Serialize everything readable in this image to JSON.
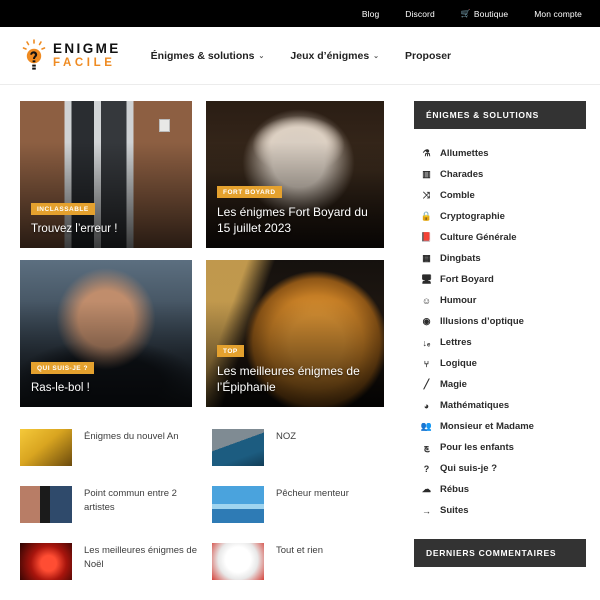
{
  "topbar": {
    "links": [
      {
        "label": "Blog",
        "icon": null
      },
      {
        "label": "Discord",
        "icon": null
      },
      {
        "label": "Boutique",
        "icon": "cart-icon",
        "glyph": "🛒"
      },
      {
        "label": "Mon compte",
        "icon": null
      }
    ]
  },
  "header": {
    "logo": {
      "line1": "ENIGME",
      "line2": "FACILE",
      "icon": "lightbulb-icon"
    },
    "nav": [
      {
        "label": "Énigmes & solutions",
        "has_caret": true,
        "caret": "⌄"
      },
      {
        "label": "Jeux d’énigmes",
        "has_caret": true,
        "caret": "⌄"
      },
      {
        "label": "Proposer",
        "has_caret": false,
        "caret": ""
      }
    ]
  },
  "cards": [
    {
      "badge": "INCLASSABLE",
      "title": "Trouvez l’erreur !",
      "image": "img-door",
      "name": "card-trouvez-l-erreur"
    },
    {
      "badge": "FORT BOYARD",
      "title": "Les énigmes Fort Boyard du 15 juillet 2023",
      "image": "img-boyard",
      "name": "card-fort-boyard"
    },
    {
      "badge": "QUI SUIS-JE ?",
      "title": "Ras-le-bol !",
      "image": "img-scream",
      "name": "card-ras-le-bol"
    },
    {
      "badge": "TOP",
      "title": "Les meilleures énigmes de l’Épiphanie",
      "image": "img-galette",
      "name": "card-epiphanie"
    }
  ],
  "article_list": [
    {
      "title": "Énigmes du nouvel An",
      "thumb": "th-nye"
    },
    {
      "title": "NOZ",
      "thumb": "th-noz"
    },
    {
      "title": "Point commun entre 2 artistes",
      "thumb": "th-artists"
    },
    {
      "title": "Pêcheur menteur",
      "thumb": "th-pecheur"
    },
    {
      "title": "Les meilleures énigmes de Noël",
      "thumb": "th-noel"
    },
    {
      "title": "Tout et rien",
      "thumb": "th-tout"
    }
  ],
  "sidebar": {
    "widget_title": "ÉNIGMES & SOLUTIONS",
    "comments_title": "DERNIERS COMMENTAIRES",
    "items": [
      {
        "label": "Allumettes",
        "icon": "match-icon",
        "glyph": "⚗"
      },
      {
        "label": "Charades",
        "icon": "columns-icon",
        "glyph": "▥"
      },
      {
        "label": "Comble",
        "icon": "shuffle-icon",
        "glyph": "⤨"
      },
      {
        "label": "Cryptographie",
        "icon": "lock-icon",
        "glyph": "🔒"
      },
      {
        "label": "Culture Générale",
        "icon": "book-icon",
        "glyph": "📕"
      },
      {
        "label": "Dingbats",
        "icon": "grid-icon",
        "glyph": "▦"
      },
      {
        "label": "Fort Boyard",
        "icon": "tv-icon",
        "glyph": "🖥"
      },
      {
        "label": "Humour",
        "icon": "smiley-icon",
        "glyph": "☺"
      },
      {
        "label": "Illusions d’optique",
        "icon": "eye-icon",
        "glyph": "◉"
      },
      {
        "label": "Lettres",
        "icon": "sort-alpha-icon",
        "glyph": "↓ₑ"
      },
      {
        "label": "Logique",
        "icon": "puzzle-icon",
        "glyph": "⑂"
      },
      {
        "label": "Magie",
        "icon": "wand-icon",
        "glyph": "╱"
      },
      {
        "label": "Mathématiques",
        "icon": "pie-chart-icon",
        "glyph": "◕"
      },
      {
        "label": "Monsieur et Madame",
        "icon": "people-icon",
        "glyph": "👥"
      },
      {
        "label": "Pour les enfants",
        "icon": "child-icon",
        "glyph": "ڇ"
      },
      {
        "label": "Qui suis-je ?",
        "icon": "question-icon",
        "glyph": "?"
      },
      {
        "label": "Rébus",
        "icon": "cloud-icon",
        "glyph": "☁"
      },
      {
        "label": "Suites",
        "icon": "arrow-right-icon",
        "glyph": "→"
      }
    ]
  },
  "colors": {
    "accent_orange": "#ef8b22",
    "badge_amber": "#e4a12e",
    "widget_header": "#333333",
    "topbar": "#000000"
  }
}
